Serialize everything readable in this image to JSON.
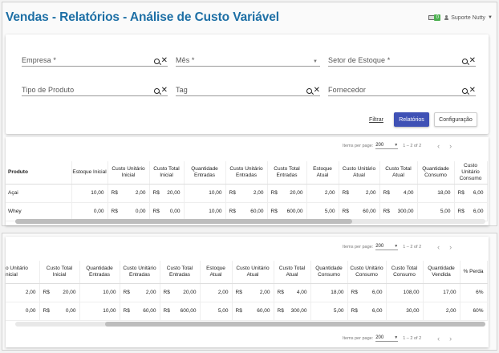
{
  "header": {
    "title": "Vendas - Relatórios - Análise de Custo Variável",
    "badge": "0",
    "user": "Suporte Nutty"
  },
  "filters": {
    "empresa": "Empresa *",
    "mes": "Mês *",
    "setor": "Setor de Estoque *",
    "tipo_produto": "Tipo de Produto",
    "tag": "Tag",
    "fornecedor": "Fornecedor"
  },
  "buttons": {
    "filtrar": "Filtrar",
    "relatorios": "Relatórios",
    "configuracao": "Configuração"
  },
  "pager": {
    "items_label": "Items per page:",
    "page_size": "200",
    "range": "1 – 2 of 2"
  },
  "table1": {
    "headers": [
      "Produto",
      "Estoque Inicial",
      "Custo Unitário Inicial",
      "Custo Total Inicial",
      "Quantidade Entradas",
      "Custo Unitário Entradas",
      "Custo Total Entradas",
      "Estoque Atual",
      "Custo Unitário Atual",
      "Custo Total Atual",
      "Quantidade Consumo",
      "Custo Unitário Consumo"
    ],
    "rows": [
      {
        "produto": "Açai",
        "estoque_inicial": "10,00",
        "cu_inicial": "2,00",
        "ct_inicial": "20,00",
        "qt_entradas": "10,00",
        "cu_entradas": "2,00",
        "ct_entradas": "20,00",
        "estoque_atual": "2,00",
        "cu_atual": "2,00",
        "ct_atual": "4,00",
        "qt_consumo": "18,00",
        "cu_consumo": "6,00"
      },
      {
        "produto": "Whey",
        "estoque_inicial": "0,00",
        "cu_inicial": "0,00",
        "ct_inicial": "0,00",
        "qt_entradas": "10,00",
        "cu_entradas": "60,00",
        "ct_entradas": "600,00",
        "estoque_atual": "5,00",
        "cu_atual": "60,00",
        "ct_atual": "300,00",
        "qt_consumo": "5,00",
        "cu_consumo": "6,00"
      }
    ]
  },
  "table2": {
    "headers": [
      "o Unitário nicial",
      "Custo Total Inicial",
      "Quantidade Entradas",
      "Custo Unitário Entradas",
      "Custo Total Entradas",
      "Estoque Atual",
      "Custo Unitário Atual",
      "Custo Total Atual",
      "Quantidade Consumo",
      "Custo Unitário Consumo",
      "Custo Total Consumo",
      "Quantidade Vendida",
      "% Perda"
    ],
    "rows": [
      {
        "cu_inicial": "2,00",
        "ct_inicial": "20,00",
        "qt_entradas": "10,00",
        "cu_entradas": "2,00",
        "ct_entradas": "20,00",
        "estoque_atual": "2,00",
        "cu_atual": "2,00",
        "ct_atual": "4,00",
        "qt_consumo": "18,00",
        "cu_consumo": "6,00",
        "ct_consumo": "108,00",
        "qt_vendida": "17,00",
        "perda": "6%"
      },
      {
        "cu_inicial": "0,00",
        "ct_inicial": "0,00",
        "qt_entradas": "10,00",
        "cu_entradas": "60,00",
        "ct_entradas": "600,00",
        "estoque_atual": "5,00",
        "cu_atual": "60,00",
        "ct_atual": "300,00",
        "qt_consumo": "5,00",
        "cu_consumo": "6,00",
        "ct_consumo": "30,00",
        "qt_vendida": "2,00",
        "perda": "60%"
      }
    ]
  },
  "currency": "R$"
}
